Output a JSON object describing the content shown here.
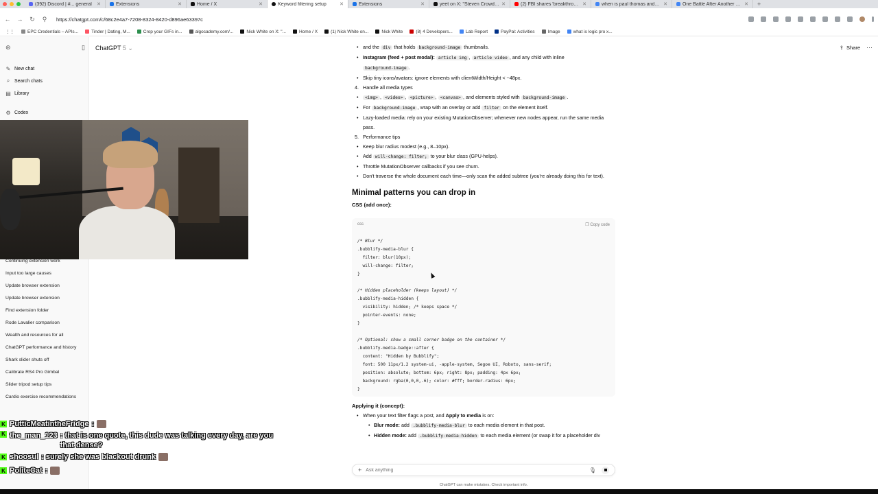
{
  "browser": {
    "tabs": [
      {
        "label": "(392) Discord | #... general",
        "color": "#5865f2"
      },
      {
        "label": "Extensions",
        "color": "#1a73e8"
      },
      {
        "label": "Home / X",
        "color": "#111111"
      },
      {
        "label": "Keyword filtering setup",
        "color": "#111111",
        "active": true
      },
      {
        "label": "Extensions",
        "color": "#1a73e8"
      },
      {
        "label": "yeet on X: \"Steven Crowder a...",
        "color": "#111111"
      },
      {
        "label": "(2) FBI shares 'breakthrough'...",
        "color": "#ff0000"
      },
      {
        "label": "when is paul thomas anderso...",
        "color": "#4285f4"
      },
      {
        "label": "One Battle After Another cas...",
        "color": "#4285f4"
      }
    ],
    "url": "https://chatgpt.com/c/68c2e4a7-7208-8324-8420-d896ae63397c",
    "bookmarks": [
      "EPC Credentials – APIs...",
      "Tinder | Dating, M...",
      "Crop your GIFs in...",
      "algocademy.com/...",
      "Nick White on X: \"...",
      "Home / X",
      "(1) Nick White on...",
      "Nick White",
      "(8) 4 Developers...",
      "Lab Report",
      "PayPal: Activities",
      "Image",
      "what is logic pro x..."
    ]
  },
  "sidebar": {
    "menu": [
      {
        "icon": "✎",
        "label": "New chat"
      },
      {
        "icon": "⌕",
        "label": "Search chats"
      },
      {
        "icon": "▤",
        "label": "Library"
      },
      {
        "icon": "⚙",
        "label": "Codex"
      }
    ],
    "chats": [
      "Continuing extension work",
      "Input too large causes",
      "Update browser extension",
      "Update browser extension",
      "Find extension folder",
      "Rode Lavalier comparison",
      "Wealth and resources for all",
      "ChatGPT performance and history",
      "Shark slider shuts off",
      "Calibrate RS4 Pro Gimbal",
      "Slider tripod setup tips",
      "Cardio exercise recommendations"
    ]
  },
  "header": {
    "model": "ChatGPT",
    "version": "5",
    "share": "Share"
  },
  "content": {
    "l1_a": "and the",
    "l1_code1": "div",
    "l1_b": "that holds",
    "l1_code2": "background-image",
    "l1_c": "thumbnails.",
    "ig_bold": "Instagram (feed + post modal):",
    "ig_code1": "article img",
    "ig_code2": "article video",
    "ig_text": ", and any child with inline",
    "ig_code3": "background-image",
    "skip": "Skip tiny icons/avatars: ignore elements with clientWidth/Height < ~48px.",
    "n4": "4.",
    "handle": "Handle all media types",
    "types_code1": "<img>",
    "types_code2": "<video>",
    "types_code3": "<picture>",
    "types_code4": "<canvas>",
    "types_text": ", and elements styled with",
    "types_code5": "background-image",
    "for_a": "For",
    "for_code1": "background-image",
    "for_b": ", wrap with an overlay or add",
    "for_code2": "filter",
    "for_c": "on the element itself.",
    "lazy": "Lazy-loaded media: rely on your existing MutationObserver; whenever new nodes appear, run the same media pass.",
    "n5": "5.",
    "perf": "Performance tips",
    "blur_tip": "Keep blur radius modest (e.g., 8–10px).",
    "add_a": "Add",
    "add_code": "will-change: filter;",
    "add_b": "to your blur class (GPU-helps).",
    "throttle": "Throttle MutationObserver callbacks if you see churn.",
    "traverse": "Don't traverse the whole document each time—only scan the added subtree (you're already doing this for text).",
    "h2": "Minimal patterns you can drop in",
    "css_head": "CSS (add once):"
  },
  "codeblock": {
    "lang": "css",
    "copy": "Copy code",
    "lines": [
      "/* Blur */",
      ".bubblify-media-blur {",
      "  filter: blur(10px);",
      "  will-change: filter;",
      "}",
      "",
      "/* Hidden placeholder (keeps layout) */",
      ".bubblify-media-hidden {",
      "  visibility: hidden; /* keeps space */",
      "  pointer-events: none;",
      "}",
      "",
      "/* Optional: show a small corner badge on the container */",
      ".bubblify-media-badge::after {",
      "  content: \"Hidden by Bubblify\";",
      "  font: 500 11px/1.2 system-ui, -apple-system, Segoe UI, Roboto, sans-serif;",
      "  position: absolute; bottom: 6px; right: 8px; padding: 4px 6px;",
      "  background: rgba(0,0,0,.6); color: #fff; border-radius: 6px;",
      "}"
    ]
  },
  "applying": {
    "head": "Applying it (concept):",
    "b1_a": "When your text filter flags a post, and",
    "b1_bold": "Apply to media",
    "b1_b": "is on:",
    "blur_bold": "Blur mode:",
    "blur_a": "add",
    "blur_code": ".bubblify-media-blur",
    "blur_b": "to each media element in that post.",
    "hidden_bold": "Hidden mode:",
    "hidden_a": "add",
    "hidden_code": ".bubblify-media-hidden",
    "hidden_b": "to each media element (or swap it for a placeholder div"
  },
  "composer": {
    "placeholder": "Ask anything",
    "disclaimer": "ChatGPT can make mistakes. Check important info."
  },
  "stream_chat": [
    {
      "user": "PutticMeatintheFridge",
      "text": ":"
    },
    {
      "user": "the_man_123",
      "text": ": that is one quote, this dude was talking every day, are you that dense?"
    },
    {
      "user": "shoosul",
      "text": ": surely she was blackout drunk"
    },
    {
      "user": "PoliteCat",
      "text": ":"
    }
  ],
  "colors": {
    "kick_green": "#53fc18",
    "accent": "#0d0d0d",
    "sidebar_bg": "#f9f9f9"
  }
}
